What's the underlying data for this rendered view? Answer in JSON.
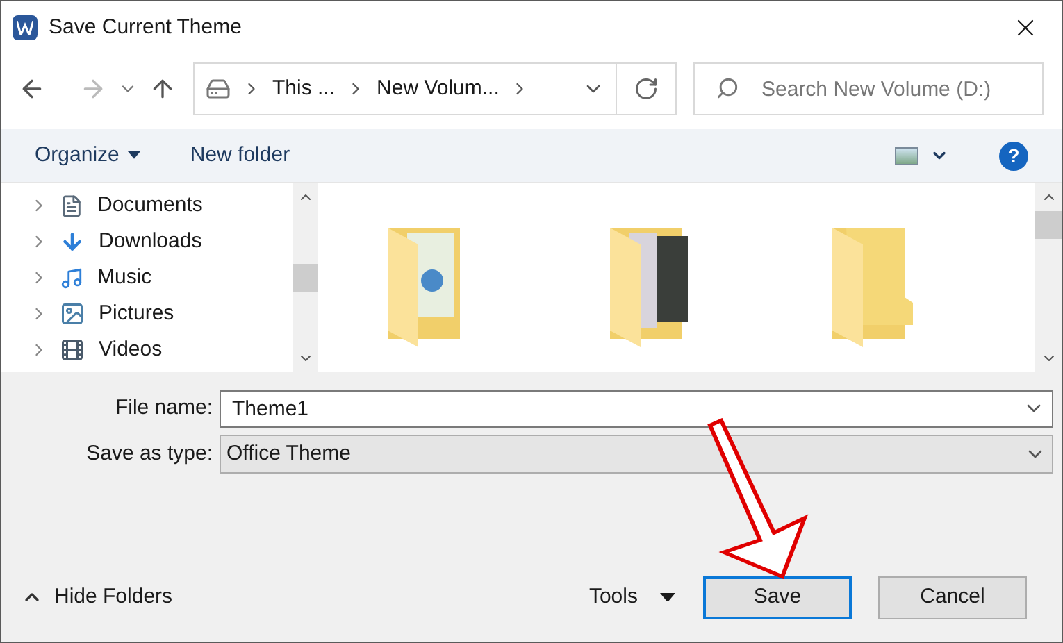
{
  "window": {
    "title": "Save Current Theme"
  },
  "address_bar": {
    "segments": [
      "This ...",
      "New Volum..."
    ]
  },
  "search": {
    "placeholder": "Search New Volume (D:)"
  },
  "toolbar": {
    "organize": "Organize",
    "new_folder": "New folder",
    "help": "?"
  },
  "sidebar": {
    "items": [
      {
        "label": "Documents",
        "kind": "documents"
      },
      {
        "label": "Downloads",
        "kind": "downloads"
      },
      {
        "label": "Music",
        "kind": "music"
      },
      {
        "label": "Pictures",
        "kind": "pictures"
      },
      {
        "label": "Videos",
        "kind": "videos"
      }
    ]
  },
  "folders": [
    {
      "kind": "collage"
    },
    {
      "kind": "photo"
    },
    {
      "kind": "empty"
    }
  ],
  "form": {
    "file_name_label": "File name:",
    "file_name": "Theme1",
    "type_label": "Save as type:",
    "type": "Office Theme"
  },
  "footer": {
    "hide_folders": "Hide Folders",
    "tools": "Tools",
    "buttons": [
      {
        "label": "Save",
        "kind": "primary"
      },
      {
        "label": "Cancel",
        "kind": "normal"
      }
    ]
  }
}
